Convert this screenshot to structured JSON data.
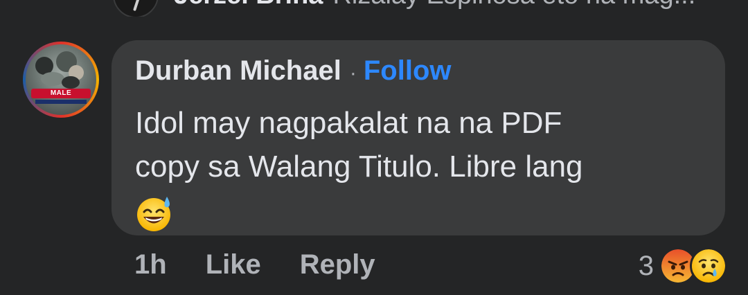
{
  "previous_reply": {
    "author": "Jerzel Brina",
    "text": "Rizalay Espinosa eto na mag",
    "ellipsis": "..."
  },
  "comment": {
    "author": "Durban Michael",
    "separator": "·",
    "follow_label": "Follow",
    "text_lines": [
      "Idol may nagpakalat na na PDF",
      "copy sa Walang Titulo. Libre lang"
    ],
    "trailing_emoji": "grinning-face-with-sweat-icon",
    "avatar_banner_text": "MALE",
    "avatar_colors": {
      "ring_primary": "#e0312b",
      "ring_secondary": "#f5b400",
      "banner": "#c8102e"
    }
  },
  "actions": {
    "time": "1h",
    "like_label": "Like",
    "reply_label": "Reply"
  },
  "reactions": {
    "count": "3",
    "icons": [
      "angry-reaction-icon",
      "sad-reaction-icon"
    ]
  },
  "colors": {
    "background": "#242526",
    "bubble": "#3a3b3c",
    "primary_text": "#e4e6eb",
    "secondary_text": "#b0b3b8",
    "link": "#2d88ff"
  }
}
